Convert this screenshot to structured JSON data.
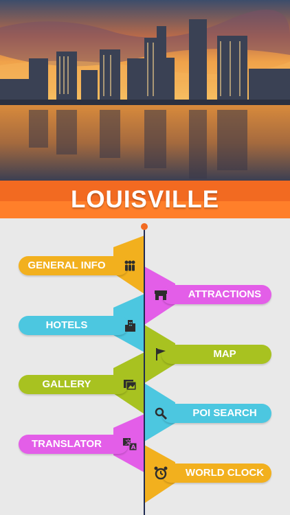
{
  "header": {
    "title": "LOUISVILLE"
  },
  "colors": {
    "accent_orange": "#f26a21",
    "yellow": "#f2b01e",
    "magenta": "#e35ee8",
    "cyan": "#4cc7e0",
    "green": "#a8c220",
    "timeline": "#1f2a52"
  },
  "menu": {
    "items": [
      {
        "label": "GENERAL INFO",
        "icon": "group-icon"
      },
      {
        "label": "ATTRACTIONS",
        "icon": "storefront-icon"
      },
      {
        "label": "HOTELS",
        "icon": "building-icon"
      },
      {
        "label": "MAP",
        "icon": "flag-icon"
      },
      {
        "label": "GALLERY",
        "icon": "photos-icon"
      },
      {
        "label": "POI SEARCH",
        "icon": "magnifier-icon"
      },
      {
        "label": "TRANSLATOR",
        "icon": "translate-icon"
      },
      {
        "label": "WORLD CLOCK",
        "icon": "alarm-clock-icon"
      }
    ]
  }
}
